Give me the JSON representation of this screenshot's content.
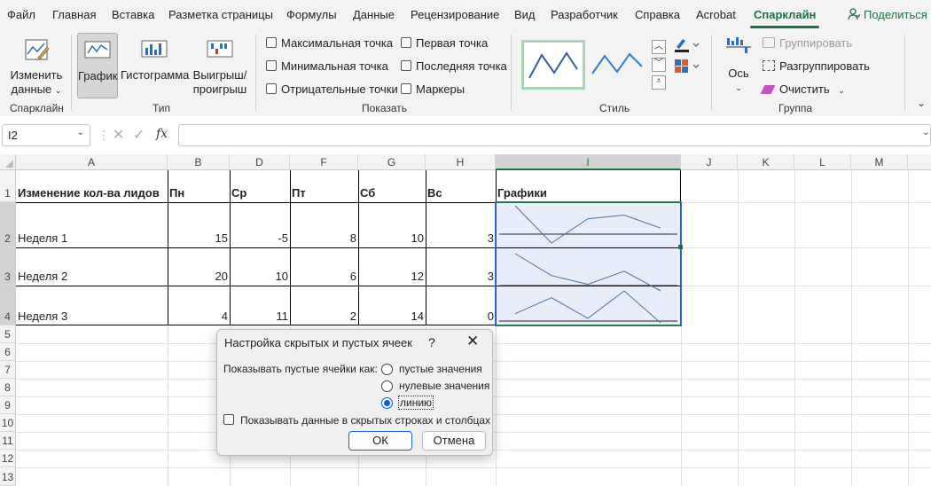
{
  "menu": {
    "items": [
      "Файл",
      "Главная",
      "Вставка",
      "Разметка страницы",
      "Формулы",
      "Данные",
      "Рецензирование",
      "Вид",
      "Разработчик",
      "Справка",
      "Acrobat",
      "Спарклайн"
    ],
    "active": "Спарклайн",
    "share": "Поделиться"
  },
  "ribbon": {
    "edit_data": {
      "line1": "Изменить",
      "line2": "данные"
    },
    "group_sparkline": "Спарклайн",
    "type_line": "График",
    "type_column": "Гистограмма",
    "type_winloss": {
      "line1": "Выигрыш/",
      "line2": "проигрыш"
    },
    "group_type": "Тип",
    "show": {
      "high_point": "Максимальная точка",
      "low_point": "Минимальная точка",
      "negative_points": "Отрицательные точки",
      "first_point": "Первая точка",
      "last_point": "Последняя точка",
      "markers": "Маркеры"
    },
    "group_show": "Показать",
    "group_style": "Стиль",
    "axis": "Ось",
    "group_btn": "Группировать",
    "ungroup_btn": "Разгруппировать",
    "clear_btn": "Очистить",
    "group_group": "Группа"
  },
  "formula_bar": {
    "name_box": "I2",
    "fx": "fx",
    "value": ""
  },
  "columns": [
    "A",
    "B",
    "D",
    "F",
    "G",
    "H",
    "I",
    "J",
    "K",
    "L",
    "M"
  ],
  "selected_column": "I",
  "rows": [
    "1",
    "2",
    "3",
    "4",
    "5",
    "6",
    "7",
    "8",
    "9",
    "10",
    "11",
    "12",
    "13"
  ],
  "table": {
    "header": [
      "Изменение кол-ва лидов",
      "Пн",
      "Ср",
      "Пт",
      "Сб",
      "Вс",
      "Графики"
    ],
    "rows": [
      {
        "label": "Неделя 1",
        "values": [
          15,
          -5,
          8,
          10,
          3
        ]
      },
      {
        "label": "Неделя 2",
        "values": [
          20,
          10,
          6,
          12,
          3
        ]
      },
      {
        "label": "Неделя 3",
        "values": [
          4,
          11,
          2,
          14,
          0
        ]
      }
    ]
  },
  "dialog": {
    "title": "Настройка скрытых и пустых ячеек",
    "help": "?",
    "show_empty_as": "Показывать пустые ячейки как:",
    "options": [
      "пустые значения",
      "нулевые значения",
      "линию"
    ],
    "selected_option": 2,
    "hidden_data": "Показывать данные в скрытых строках и столбцах",
    "ok": "ОК",
    "cancel": "Отмена"
  },
  "colors": {
    "accent": "#1e7145",
    "sparkline": "#4a6fa5",
    "selection_fill": "#e8eef9"
  }
}
